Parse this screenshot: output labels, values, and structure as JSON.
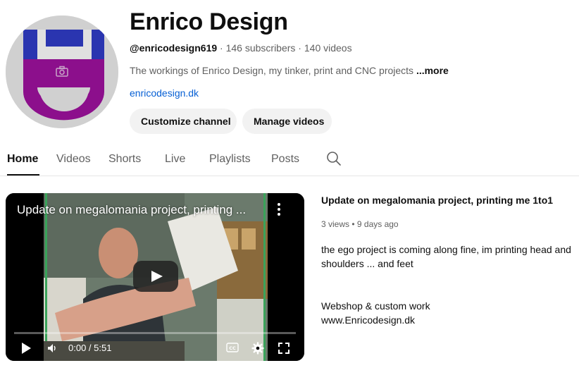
{
  "channel": {
    "name": "Enrico Design",
    "handle": "@enricodesign619",
    "separator": " · ",
    "subscribers": "146 subscribers",
    "videos": "140 videos",
    "description": "The workings of Enrico Design, my tinker, print and CNC projects",
    "more_label": "...more",
    "link": "enricodesign.dk",
    "avatar_icon": "camera-icon",
    "colors": {
      "avatar_bg": "#d0d0d0",
      "avatar_blue": "#2a35b0",
      "avatar_purple": "#8c0f8c"
    }
  },
  "actions": {
    "customize_label": "Customize channel",
    "manage_label": "Manage videos"
  },
  "tabs": [
    {
      "label": "Home",
      "active": true
    },
    {
      "label": "Videos"
    },
    {
      "label": "Shorts"
    },
    {
      "label": "Live"
    },
    {
      "label": "Playlists"
    },
    {
      "label": "Posts"
    }
  ],
  "featured": {
    "player_title": "Update on megalomania project, printing ...",
    "title": "Update on megalomania project, printing me 1to1",
    "views": "3 views",
    "dot": " • ",
    "age": "9 days ago",
    "description_line1": "the ego project is coming along fine, im printing head and shoulders ... and feet",
    "description_line2": "Webshop & custom work",
    "description_line3": "www.Enricodesign.dk",
    "time": "0:00 / 5:51",
    "progress": 0.0
  }
}
